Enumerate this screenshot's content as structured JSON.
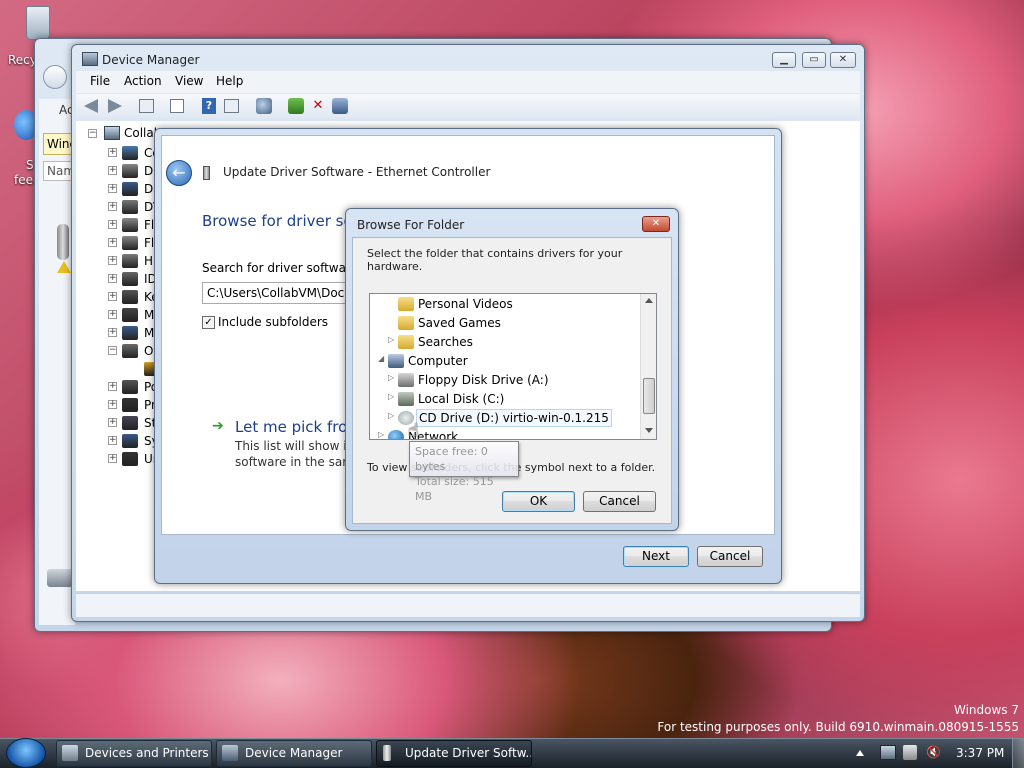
{
  "desktop": {
    "recycle_label": "Recy",
    "feed_label_1": "S",
    "feed_label_2": "feeds",
    "watermark_title": "Windows 7",
    "watermark_build": "For testing purposes only. Build 6910.winmain.080915-1555"
  },
  "devices_window": {
    "addr_fragment": "Ac",
    "win_label": "Wind",
    "name_label": "Nam"
  },
  "device_manager": {
    "title": "Device Manager",
    "menu": [
      "File",
      "Action",
      "View",
      "Help"
    ],
    "root_label": "Collab",
    "tree_items": [
      "Co",
      "Di",
      "Di",
      "DV",
      "Fl",
      "Fl",
      "Hu",
      "ID",
      "Ke",
      "M",
      "M",
      "Ot",
      "",
      "Po",
      "Pr",
      "St",
      "Sy",
      "Ur"
    ]
  },
  "update_dialog": {
    "title": "Update Driver Software - Ethernet Controller",
    "heading": "Browse for driver sof",
    "search_label": "Search for driver software in",
    "path_value": "C:\\Users\\CollabVM\\Docun",
    "include_subfolders": "Include subfolders",
    "pick_title": "Let me pick from",
    "pick_desc_1": "This list will show inst",
    "pick_desc_2": "software in the same",
    "next_label": "Next",
    "cancel_label": "Cancel"
  },
  "browse_dialog": {
    "title": "Browse For Folder",
    "instruction": "Select the folder that contains drivers for your hardware.",
    "items": [
      {
        "label": "Personal Videos",
        "icon": "folder-icon"
      },
      {
        "label": "Saved Games",
        "icon": "folder-icon"
      },
      {
        "label": "Searches",
        "icon": "folder-icon"
      },
      {
        "label": "Computer",
        "icon": "computer-icon"
      },
      {
        "label": "Floppy Disk Drive (A:)",
        "icon": "floppy-icon"
      },
      {
        "label": "Local Disk (C:)",
        "icon": "disk-icon"
      },
      {
        "label": "CD Drive (D:) virtio-win-0.1.215",
        "icon": "cd-icon"
      },
      {
        "label": "Network",
        "icon": "network-icon"
      }
    ],
    "tooltip_line1": "Space free: 0 bytes",
    "tooltip_line2": "Total size: 515 MB",
    "hint": "To view subfolders, click the symbol next to a folder.",
    "ok_label": "OK",
    "cancel_label": "Cancel"
  },
  "taskbar": {
    "buttons": [
      "Devices and Printers",
      "Device Manager",
      "Update Driver Softw..."
    ],
    "clock": "3:37 PM"
  }
}
